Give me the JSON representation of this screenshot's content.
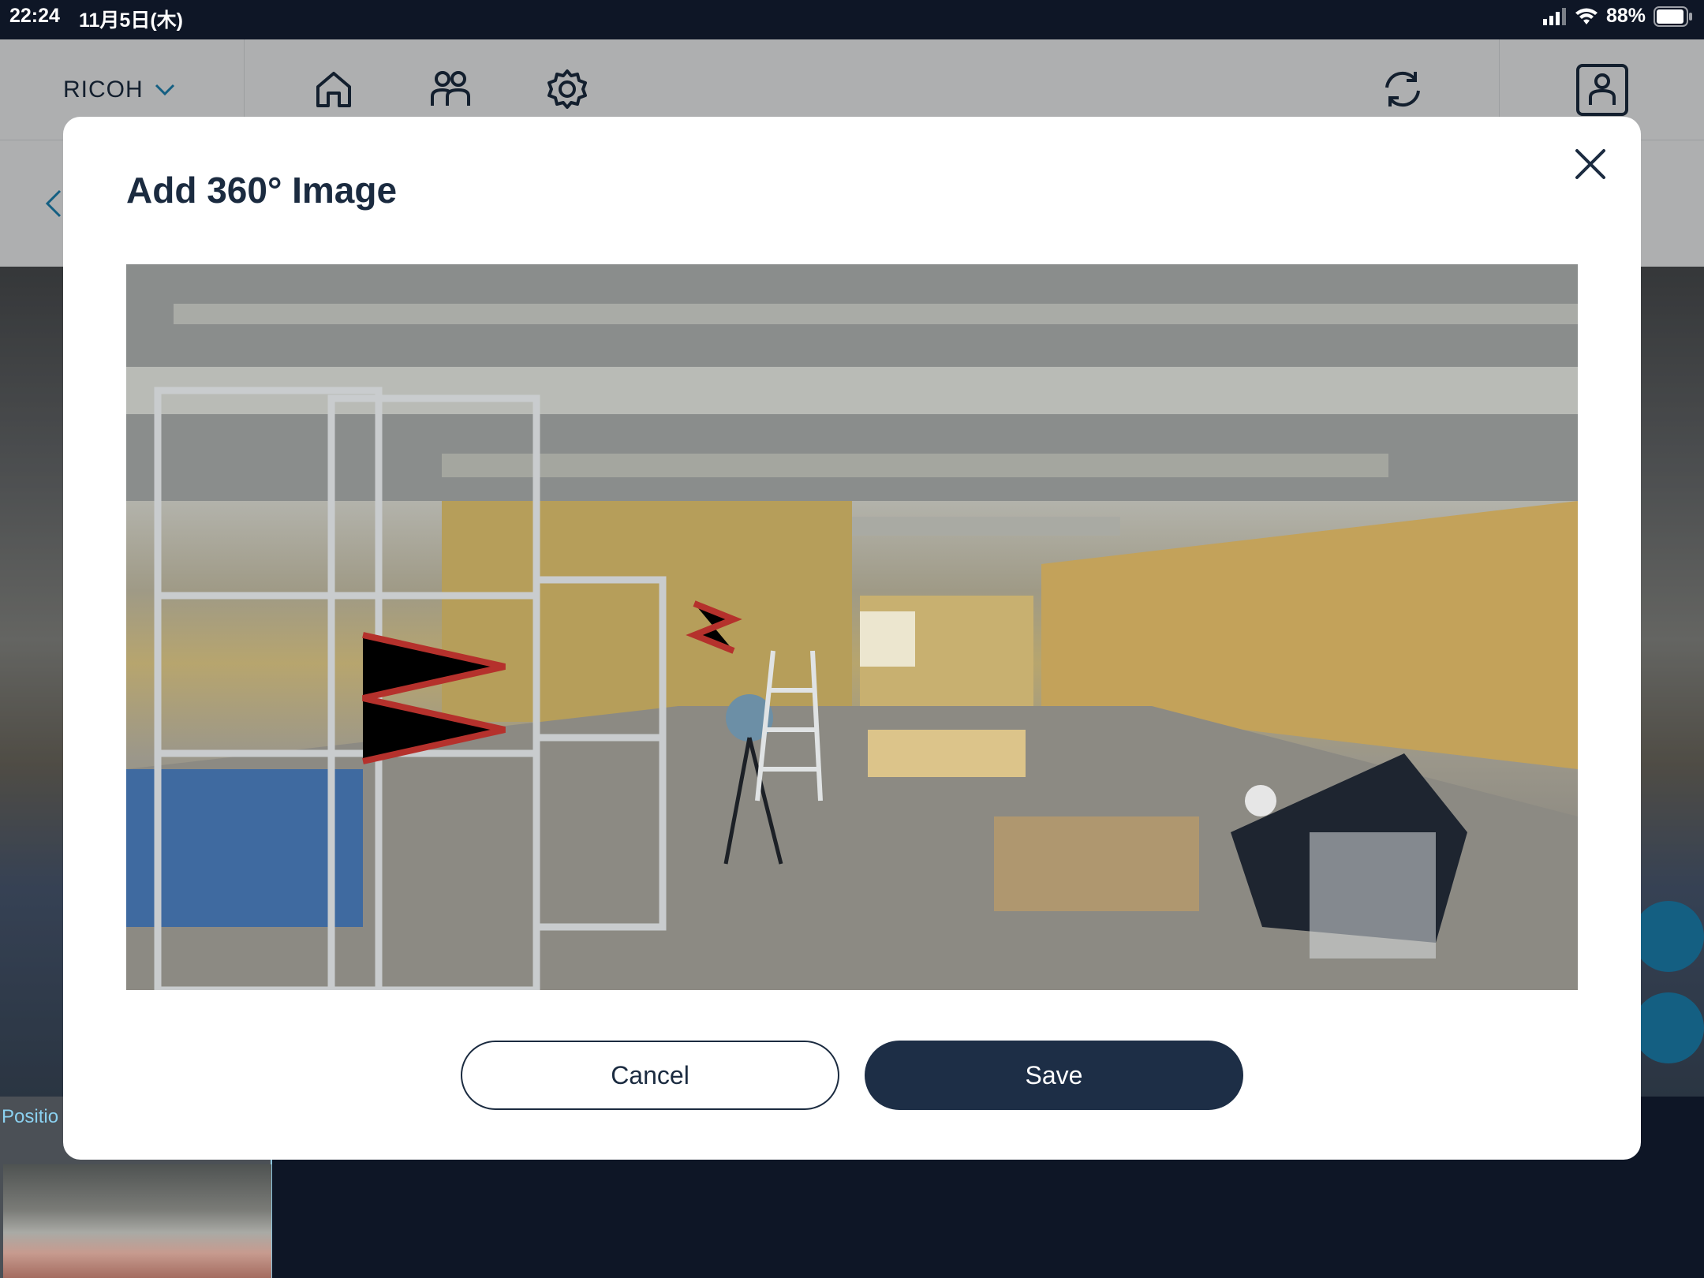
{
  "status_bar": {
    "time": "22:24",
    "date": "11月5日(木)",
    "battery": "88%"
  },
  "header": {
    "org_name": "RICOH"
  },
  "thumbnail": {
    "label": "Positio"
  },
  "modal": {
    "title": "Add 360° Image",
    "cancel_label": "Cancel",
    "save_label": "Save"
  },
  "colors": {
    "primary": "#1d2e46",
    "accent": "#1d84b5",
    "text": "#1b2b40"
  }
}
